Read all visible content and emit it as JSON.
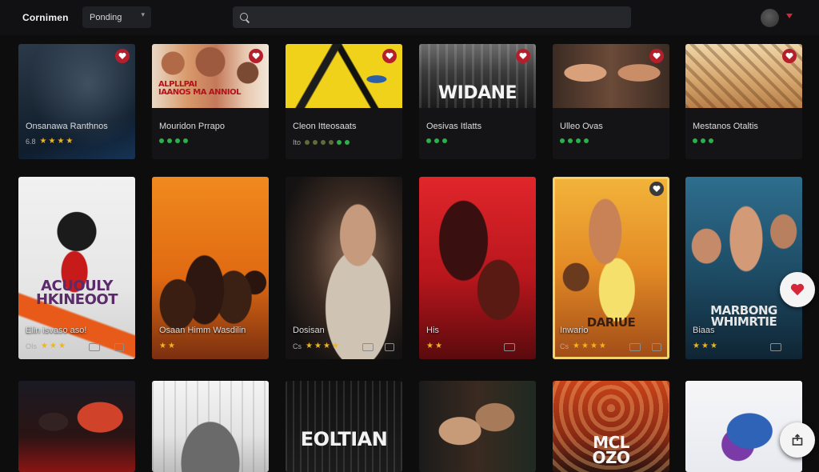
{
  "header": {
    "brand": "Cornimen",
    "dropdown_value": "Ponding",
    "search_icon_text": "Q",
    "search_placeholder": ""
  },
  "rows": [
    {
      "cards": [
        {
          "title": "Onsanawa Ranthnos",
          "rating_label": "6.8",
          "rating_kind": "stars",
          "rating_count": 4,
          "poster_text": "",
          "favorite": false
        },
        {
          "title": "Mouridon Prrapo",
          "rating_label": "",
          "rating_kind": "dots",
          "rating_count": 4,
          "poster_text": "ALPLLPAI\nIAANOS MA ANNIOL",
          "favorite": true
        },
        {
          "title": "Cleon Itteosaats",
          "rating_label": "Ito",
          "rating_kind": "dots",
          "rating_count": 6,
          "poster_text": "",
          "favorite": true
        },
        {
          "title": "Oesivas Itlatts",
          "rating_label": "",
          "rating_kind": "dots",
          "rating_count": 3,
          "poster_text": "WIDANE",
          "favorite": true
        },
        {
          "title": "Ulleo Ovas",
          "rating_label": "",
          "rating_kind": "dots",
          "rating_count": 4,
          "poster_text": "",
          "favorite": true
        },
        {
          "title": "Mestanos Otaltis",
          "rating_label": "",
          "rating_kind": "dots",
          "rating_count": 3,
          "poster_text": "",
          "favorite": true
        }
      ]
    },
    {
      "cards": [
        {
          "title": "Elin isvaso aso!",
          "rating_label": "OIs",
          "rating_kind": "stars",
          "rating_count": 3,
          "poster_text": "ACUOULY\nHKINEOOT",
          "favorite": false
        },
        {
          "title": "Osaan Himm Wasdilin",
          "rating_label": "",
          "rating_kind": "stars",
          "rating_count": 2,
          "poster_text": "",
          "favorite": false
        },
        {
          "title": "Dosisan",
          "rating_label": "Cs",
          "rating_kind": "stars",
          "rating_count": 4,
          "poster_text": "",
          "favorite": false
        },
        {
          "title": "His",
          "rating_label": "",
          "rating_kind": "stars",
          "rating_count": 2,
          "poster_text": "",
          "favorite": false
        },
        {
          "title": "Inwario",
          "rating_label": "Cs",
          "rating_kind": "stars",
          "rating_count": 4,
          "poster_text": "DARIUE",
          "favorite": false
        },
        {
          "title": "Biaas",
          "rating_label": "",
          "rating_kind": "stars",
          "rating_count": 3,
          "poster_text": "MARBONG\nWHIMRTIE",
          "favorite": false
        }
      ]
    },
    {
      "cards": [
        {
          "title": "",
          "rating_label": "",
          "rating_kind": "none",
          "rating_count": 0,
          "poster_text": "",
          "favorite": false
        },
        {
          "title": "",
          "rating_label": "",
          "rating_kind": "none",
          "rating_count": 0,
          "poster_text": "",
          "favorite": false
        },
        {
          "title": "",
          "rating_label": "",
          "rating_kind": "none",
          "rating_count": 0,
          "poster_text": "EOLTIAN",
          "favorite": false
        },
        {
          "title": "",
          "rating_label": "",
          "rating_kind": "none",
          "rating_count": 0,
          "poster_text": "",
          "favorite": false
        },
        {
          "title": "",
          "rating_label": "",
          "rating_kind": "none",
          "rating_count": 0,
          "poster_text": "MCL\nOZO",
          "favorite": false
        },
        {
          "title": "",
          "rating_label": "",
          "rating_kind": "none",
          "rating_count": 0,
          "poster_text": "",
          "favorite": false
        }
      ]
    }
  ],
  "colors": {
    "accent": "#d6263a",
    "star": "#f2b417",
    "rating_dot": "#2bb04a",
    "background": "#0d0d0e"
  },
  "icons": {
    "card_favorite": "heart-icon",
    "side_favorite": "heart-icon",
    "side_share": "share-icon",
    "search": "search-icon"
  }
}
